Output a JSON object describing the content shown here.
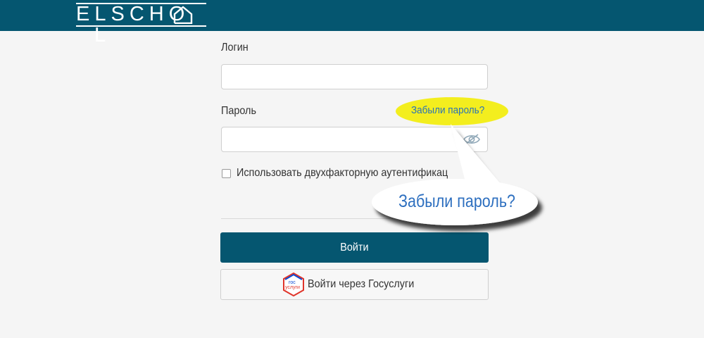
{
  "header": {
    "logo_text": "ELSCHO",
    "logo_letter_end": "L"
  },
  "form": {
    "login_label": "Логин",
    "login_value": "",
    "password_label": "Пароль",
    "password_value": "",
    "forgot_link": "Забыли пароль?",
    "two_factor_label": "Использовать двухфакторную аутентификац",
    "login_button": "Войти",
    "gosuslugi_button": "Войти через Госуслуги",
    "gosuslugi_logo_line1": "гос",
    "gosuslugi_logo_line2": "услуги"
  },
  "callout": {
    "text": "Забыли пароль?"
  },
  "colors": {
    "brand": "#055670",
    "link": "#2a73b8",
    "highlight": "#f3ee1e"
  }
}
